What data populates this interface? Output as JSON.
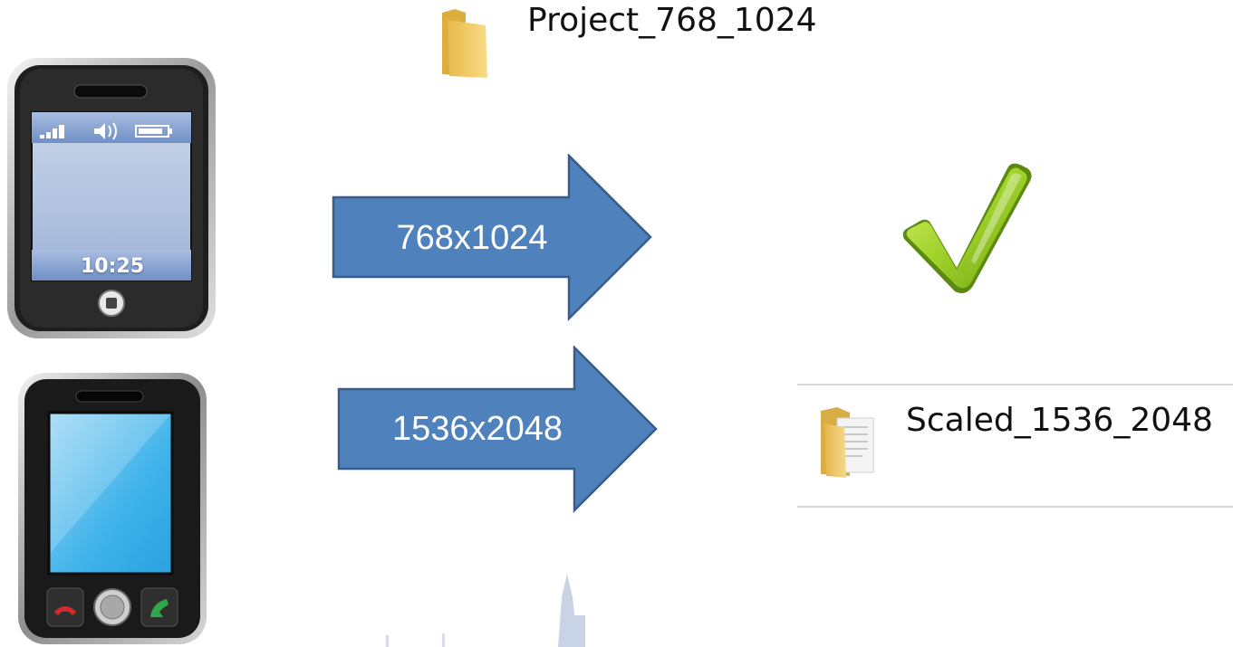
{
  "folders": {
    "top": {
      "label": "Project_768_1024",
      "icon": "folder-icon"
    },
    "scaled": {
      "label": "Scaled_1536_2048",
      "icon": "folder-document-icon"
    }
  },
  "arrows": {
    "top": {
      "label": "768x1024"
    },
    "bottom": {
      "label": "1536x2048"
    }
  },
  "phones": {
    "classic": {
      "time": "10:25",
      "icon": "phone-classic-icon"
    },
    "smart": {
      "icon": "smartphone-icon"
    }
  },
  "result": {
    "icon": "checkmark-icon"
  },
  "colors": {
    "arrow_fill": "#4f81bd",
    "arrow_stroke": "#385d8a",
    "check_green": "#8cc21f",
    "folder_yellow": "#f5d57a"
  }
}
